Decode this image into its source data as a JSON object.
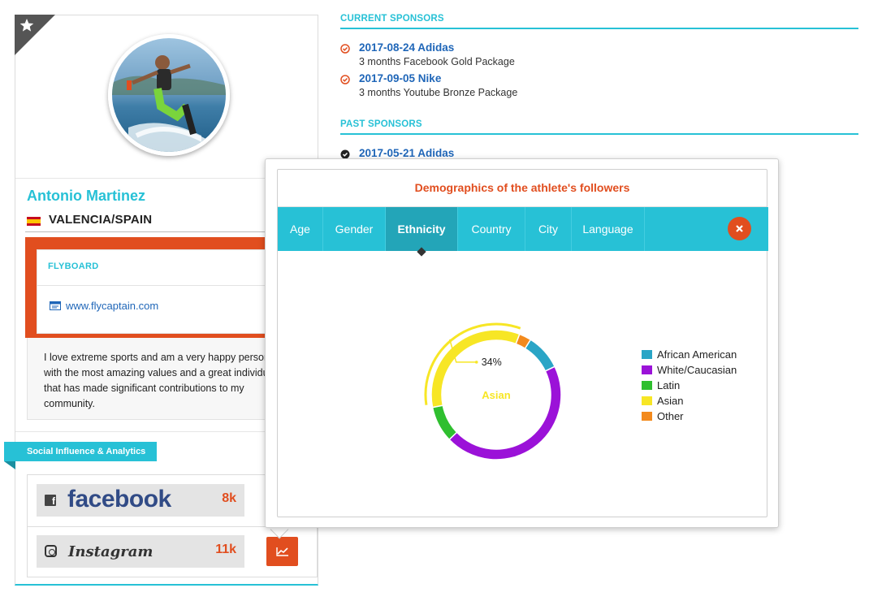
{
  "profile": {
    "name": "Antonio Martinez",
    "location": "VALENCIA/SPAIN",
    "sport": "FLYBOARD",
    "website": "www.flycaptain.com",
    "bio": "I love extreme sports and am a very happy person with the most amazing values and a great individual that has made significant contributions to my community."
  },
  "social": {
    "section_label": "Social Influence & Analytics",
    "facebook": {
      "label": "facebook",
      "count": "8k"
    },
    "instagram": {
      "label": "Instagram",
      "count": "11k"
    }
  },
  "sponsors": {
    "current_title": "CURRENT SPONSORS",
    "current": [
      {
        "title": "2017-08-24 Adidas",
        "subtitle": "3 months Facebook Gold Package"
      },
      {
        "title": "2017-09-05 Nike",
        "subtitle": "3 months Youtube Bronze Package"
      }
    ],
    "past_title": "PAST SPONSORS",
    "past": [
      {
        "title": "2017-05-21 Adidas"
      }
    ]
  },
  "popup": {
    "title": "Demographics of the athlete's followers",
    "tabs": [
      "Age",
      "Gender",
      "Ethnicity",
      "Country",
      "City",
      "Language"
    ],
    "active_tab": "Ethnicity"
  },
  "colors": {
    "accent": "#27c1d6",
    "orange": "#e14e1f",
    "link": "#1f66b8"
  },
  "chart_data": {
    "type": "pie",
    "title": "Demographics of the athlete's followers",
    "donut": true,
    "center_label": "Asian",
    "highlighted": "Asian",
    "highlight_label": "34%",
    "legend_position": "right",
    "series": [
      {
        "name": "African American",
        "value": 9,
        "color": "#2aa5c6"
      },
      {
        "name": "White/Caucasian",
        "value": 45,
        "color": "#9b12d8"
      },
      {
        "name": "Latin",
        "value": 9,
        "color": "#2fbf2f"
      },
      {
        "name": "Asian",
        "value": 34,
        "color": "#f7e625"
      },
      {
        "name": "Other",
        "value": 3,
        "color": "#f38a1d"
      }
    ]
  }
}
